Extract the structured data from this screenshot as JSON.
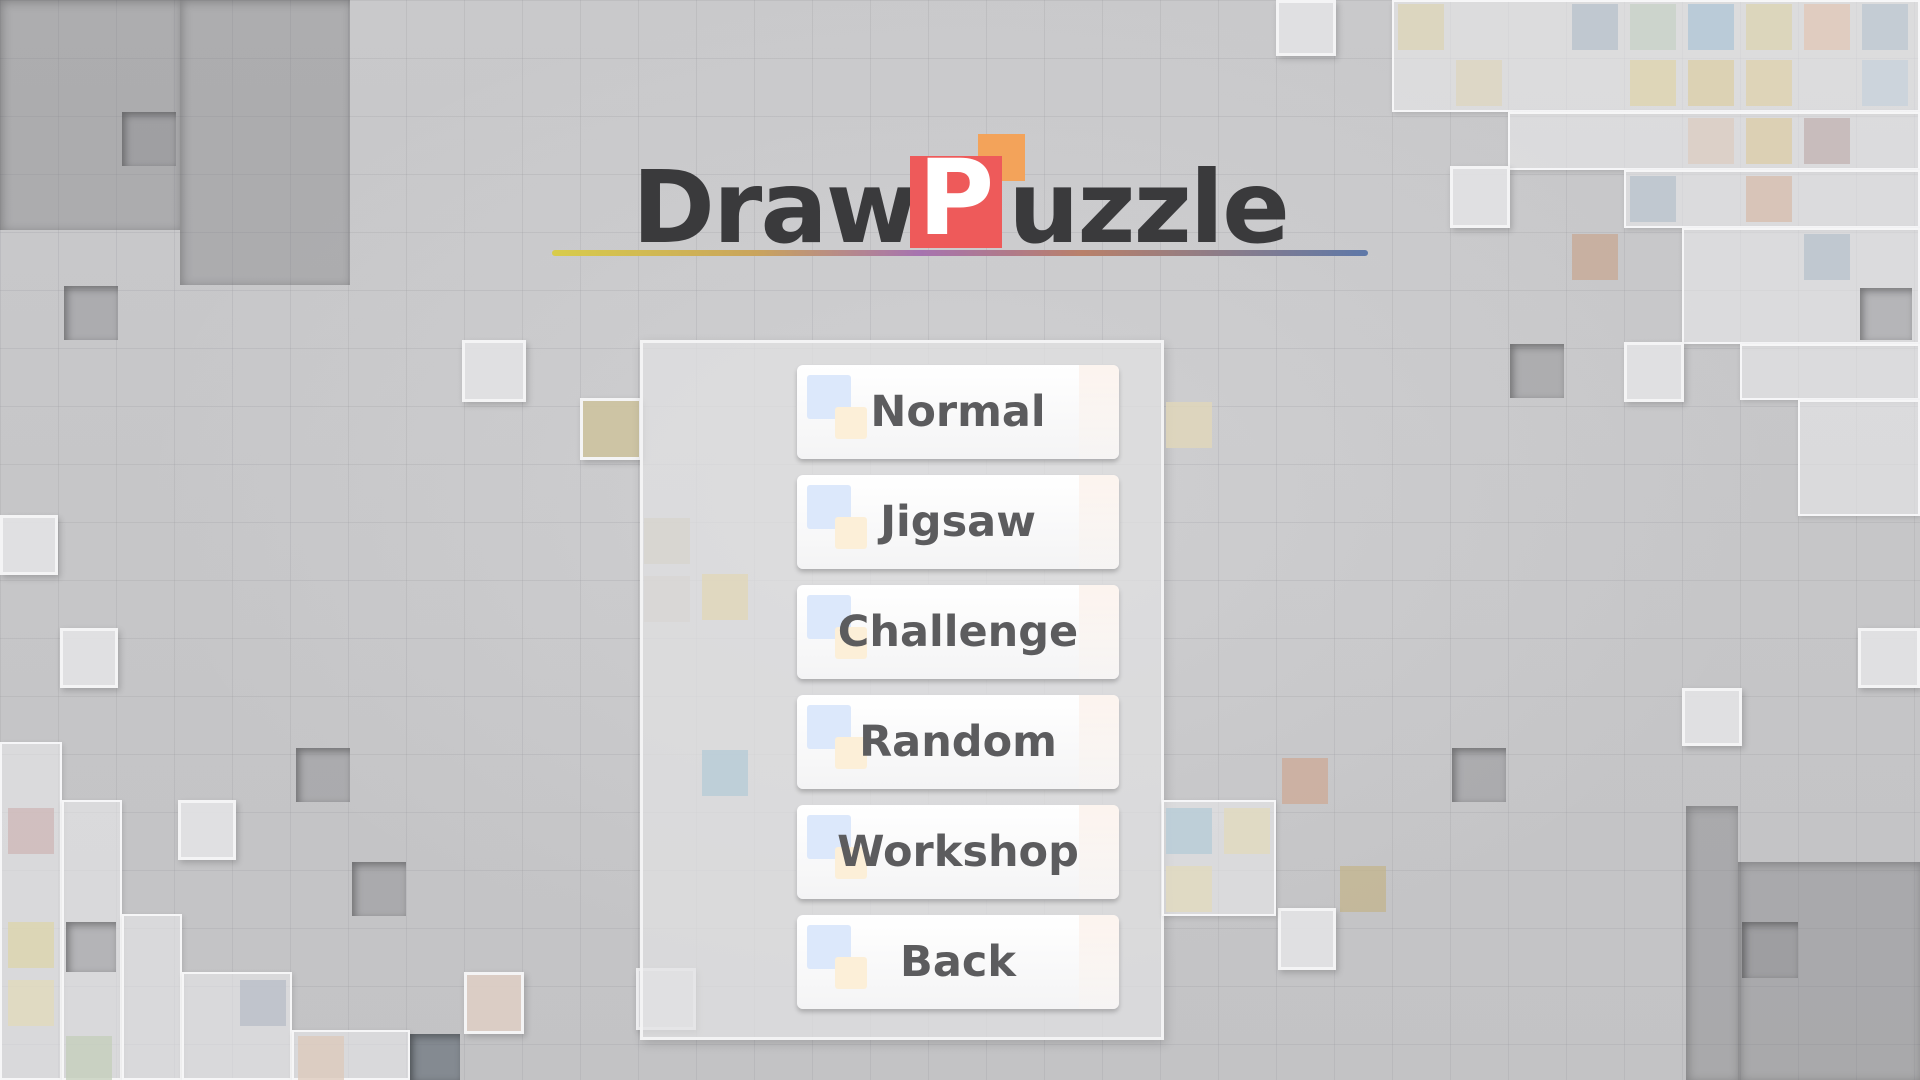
{
  "title": {
    "part1": "Draw",
    "logo_letter": "P",
    "part2": "uzzle"
  },
  "menu": {
    "items": [
      {
        "label": "Normal"
      },
      {
        "label": "Jigsaw"
      },
      {
        "label": "Challenge"
      },
      {
        "label": "Random"
      },
      {
        "label": "Workshop"
      },
      {
        "label": "Back"
      }
    ]
  },
  "colors": {
    "logo_red": "#ee5a5a",
    "logo_orange": "#f3a35a",
    "title_text": "#3a3a3c",
    "button_text": "#5c5c5e"
  }
}
